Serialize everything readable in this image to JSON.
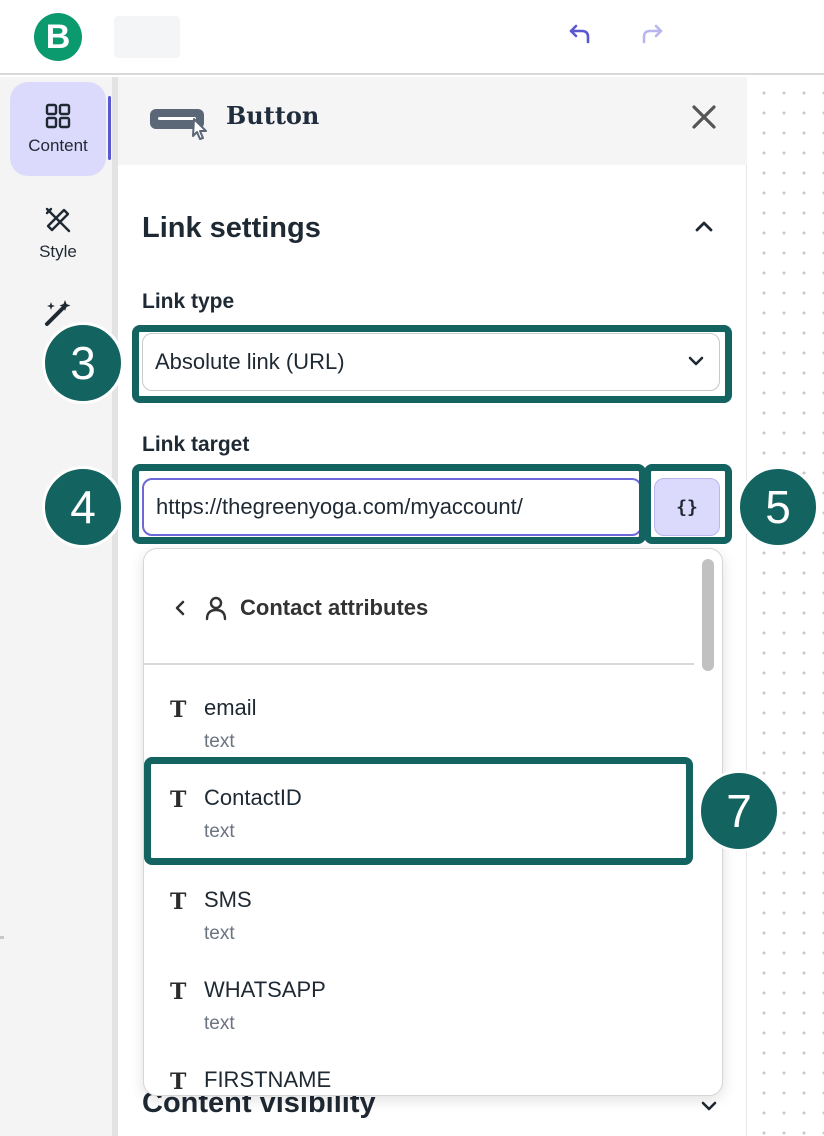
{
  "topbar": {
    "logo_letter": "B",
    "undo_icon": "undo-icon",
    "redo_icon": "redo-icon",
    "brand_color": "#0b996e"
  },
  "rail": {
    "items": [
      {
        "label": "Content",
        "icon": "grid-icon",
        "active": true
      },
      {
        "label": "Style",
        "icon": "pen-ruler-icon",
        "active": false
      },
      {
        "label": "",
        "icon": "magic-wand-icon",
        "active": false
      }
    ],
    "active_color": "#dcdafc"
  },
  "panel": {
    "title": "Button",
    "title_icon": "button-cursor-icon",
    "close_icon": "close-icon",
    "section_title": "Link settings",
    "link_type": {
      "label": "Link type",
      "value": "Absolute link (URL)"
    },
    "link_target": {
      "label": "Link target",
      "value": "https://thegreenyoga.com/myaccount/",
      "var_button": "{}"
    },
    "content_visibility": "Content visibility"
  },
  "dropdown": {
    "title": "Contact attributes",
    "items": [
      {
        "name": "email",
        "type": "text"
      },
      {
        "name": "ContactID",
        "type": "text"
      },
      {
        "name": "SMS",
        "type": "text"
      },
      {
        "name": "WHATSAPP",
        "type": "text"
      },
      {
        "name": "FIRSTNAME",
        "type": ""
      }
    ]
  },
  "annotations": {
    "color": "#136361",
    "badges": [
      "3",
      "4",
      "5",
      "7"
    ]
  }
}
